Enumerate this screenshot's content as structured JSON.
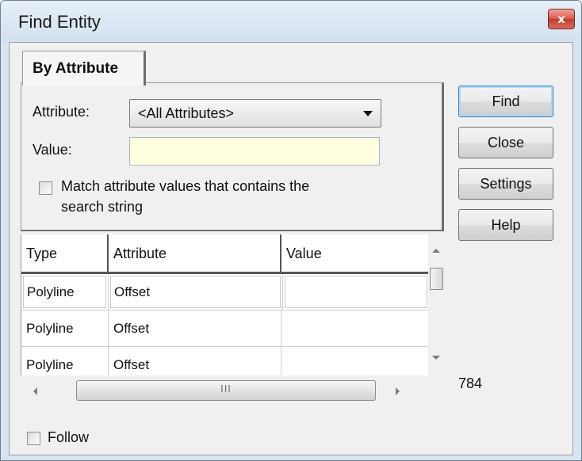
{
  "window": {
    "title": "Find Entity",
    "close_glyph": "x"
  },
  "tab": {
    "label": "By Attribute"
  },
  "form": {
    "attribute_label": "Attribute:",
    "attribute_value": "<All Attributes>",
    "value_label": "Value:",
    "value_text": "",
    "match_label_line1": "Match attribute values that contains the",
    "match_label_line2": "search string",
    "match_checked": false
  },
  "buttons": {
    "find": "Find",
    "close": "Close",
    "settings": "Settings",
    "help": "Help"
  },
  "grid": {
    "columns": [
      "Type",
      "Attribute",
      "Value"
    ],
    "rows": [
      {
        "type": "Polyline",
        "attribute": "Offset",
        "value": ""
      },
      {
        "type": "Polyline",
        "attribute": "Offset",
        "value": ""
      },
      {
        "type": "Polyline",
        "attribute": "Offset",
        "value": ""
      }
    ],
    "selected_row": 0
  },
  "hscroll_grip": "III",
  "result_count": "784",
  "follow": {
    "label": "Follow",
    "checked": false
  },
  "colors": {
    "value_field_bg": "#ffffe0",
    "default_button_border": "#3c7fb1",
    "close_button_red": "#c23b2d"
  },
  "icons": {
    "close": "close-icon",
    "dropdown": "chevron-down-icon",
    "scroll_up": "scroll-up-arrow-icon",
    "scroll_down": "scroll-down-arrow-icon",
    "scroll_left": "scroll-left-arrow-icon",
    "scroll_right": "scroll-right-arrow-icon"
  }
}
